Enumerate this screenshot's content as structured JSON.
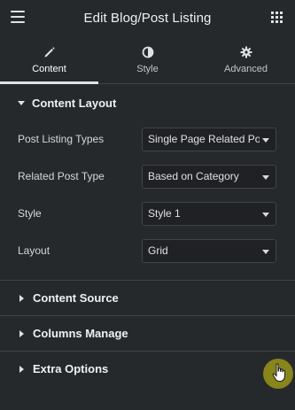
{
  "header": {
    "title": "Edit Blog/Post Listing",
    "menu_icon": "hamburger-icon",
    "apps_icon": "grid-icon"
  },
  "tabs": [
    {
      "label": "Content",
      "icon": "pencil-icon",
      "active": true
    },
    {
      "label": "Style",
      "icon": "half-circle-icon",
      "active": false
    },
    {
      "label": "Advanced",
      "icon": "gear-icon",
      "active": false
    }
  ],
  "content_layout": {
    "title": "Content Layout",
    "controls": [
      {
        "label": "Post Listing Types",
        "value": "Single Page Related Posts"
      },
      {
        "label": "Related Post Type",
        "value": "Based on Category"
      },
      {
        "label": "Style",
        "value": "Style 1"
      },
      {
        "label": "Layout",
        "value": "Grid"
      }
    ]
  },
  "sections": [
    {
      "title": "Content Source"
    },
    {
      "title": "Columns Manage"
    },
    {
      "title": "Extra Options"
    }
  ],
  "colors": {
    "panel_bg": "#26292c",
    "control_bg": "#1f2124",
    "border": "#3f444b",
    "text": "#e0e1e3",
    "cursor_highlight": "#8d8a1a"
  }
}
